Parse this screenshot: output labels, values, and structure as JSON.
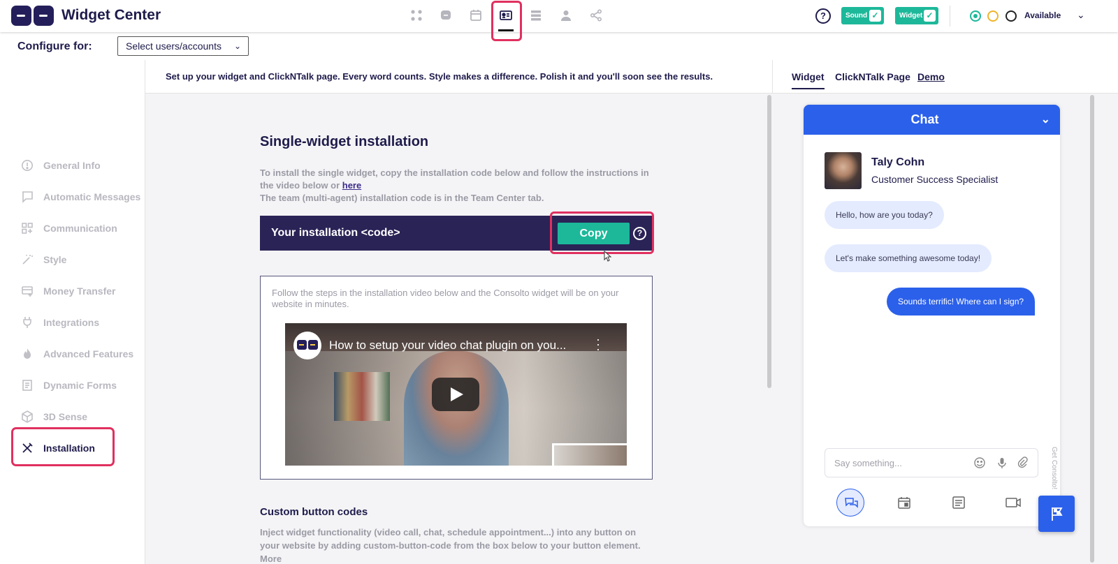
{
  "app": {
    "title": "Widget Center"
  },
  "topnav": {
    "icons": [
      "apps-icon",
      "chat-bubble-icon",
      "calendar-icon",
      "id-card-icon",
      "list-icon",
      "person-icon",
      "share-icon"
    ],
    "active": "id-card-icon",
    "help": "?",
    "sound_label": "Sound",
    "widget_label": "Widget",
    "status_label": "Available",
    "status_colors": [
      "#1db89a",
      "#f0b429",
      "#222222"
    ]
  },
  "configure": {
    "label": "Configure for:",
    "select_value": "Select users/accounts"
  },
  "sidebar": {
    "items": [
      {
        "label": "General Info",
        "icon": "info-icon"
      },
      {
        "label": "Automatic Messages",
        "icon": "message-icon"
      },
      {
        "label": "Communication",
        "icon": "grid-plus-icon"
      },
      {
        "label": "Style",
        "icon": "magic-wand-icon"
      },
      {
        "label": "Money Transfer",
        "icon": "card-icon"
      },
      {
        "label": "Integrations",
        "icon": "plug-icon"
      },
      {
        "label": "Advanced Features",
        "icon": "flame-icon"
      },
      {
        "label": "Dynamic Forms",
        "icon": "form-icon"
      },
      {
        "label": "3D Sense",
        "icon": "cube-icon"
      },
      {
        "label": "Installation",
        "icon": "tools-icon"
      }
    ],
    "active": "Installation"
  },
  "main": {
    "intro": "Set up your widget and ClickNTalk page. Every word counts. Style makes a difference. Polish it and you'll soon see the results.",
    "heading": "Single-widget installation",
    "desc_part1": "To install the single widget, copy the installation code below and follow the instructions in the video below or ",
    "desc_link": "here",
    "desc_part2": "The team (multi-agent) installation code is in the Team Center tab.",
    "code_label": "Your installation <code>",
    "copy_label": "Copy",
    "copy_help": "?",
    "video_text": "Follow the steps in the installation video below and the Consolto widget will be on your website in minutes.",
    "video_title": "How to setup your video chat plugin on you...",
    "custom_heading": "Custom button codes",
    "custom_desc": "Inject widget functionality (video call, chat, schedule appointment...) into any button on your website by adding custom-button-code from the box below to your button element. More"
  },
  "right": {
    "tabs": [
      "Widget",
      "ClickNTalk Page",
      "Demo"
    ],
    "active_tab": "Widget",
    "chat": {
      "title": "Chat",
      "agent_name": "Taly Cohn",
      "agent_role": "Customer Success Specialist",
      "messages": [
        {
          "text": "Hello, how are you today?",
          "from": "agent"
        },
        {
          "text": "Let's make something awesome today!",
          "from": "agent"
        },
        {
          "text": "Sounds terrific! Where can I sign?",
          "from": "user"
        }
      ],
      "input_placeholder": "Say something...",
      "branding": "Get Consolto!",
      "accent_color": "#2b60ea"
    }
  }
}
